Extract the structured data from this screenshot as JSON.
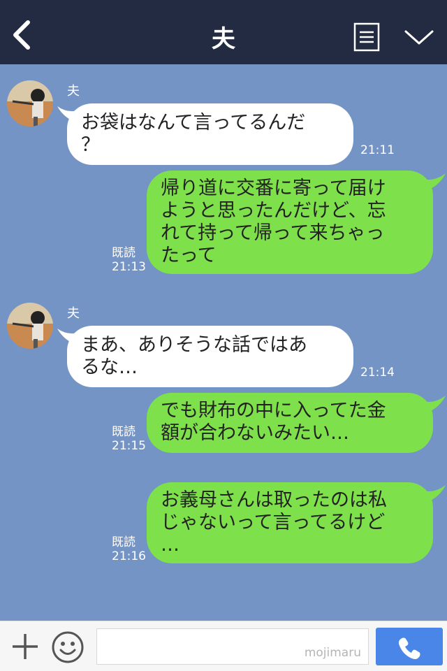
{
  "header": {
    "title": "夫",
    "back_icon": "chevron-left-icon",
    "notes_icon": "notes-icon",
    "menu_icon": "chevron-down-icon"
  },
  "messages": [
    {
      "from": "partner",
      "sender": "夫",
      "lines": [
        "お袋はなんて言ってるんだ",
        "？"
      ],
      "time": "21:11"
    },
    {
      "from": "me",
      "read_label": "既読",
      "lines": [
        "帰り道に交番に寄って届け",
        "ようと思ったんだけど、忘",
        "れて持って帰って来ちゃっ",
        "たって"
      ],
      "time": "21:13"
    },
    {
      "from": "partner",
      "sender": "夫",
      "lines": [
        "まあ、ありそうな話ではあ",
        "るな…"
      ],
      "time": "21:14"
    },
    {
      "from": "me",
      "read_label": "既読",
      "lines": [
        "でも財布の中に入ってた金",
        "額が合わないみたい…"
      ],
      "time": "21:15"
    },
    {
      "from": "me",
      "read_label": "既読",
      "lines": [
        "お義母さんは取ったのは私",
        "じゃないって言ってるけど",
        "…"
      ],
      "time": "21:16"
    }
  ],
  "footer": {
    "watermark": "mojimaru",
    "plus_icon": "plus-icon",
    "emoji_icon": "smiley-icon",
    "call_icon": "phone-icon"
  },
  "colors": {
    "header_bg": "#232b42",
    "chat_bg": "#7494c6",
    "incoming_bubble": "#ffffff",
    "outgoing_bubble": "#7ee04a",
    "call_button": "#4a86e8"
  }
}
